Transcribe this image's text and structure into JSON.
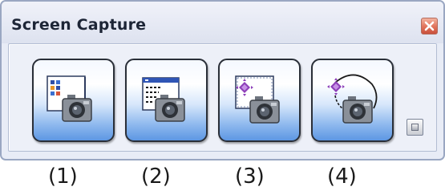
{
  "window": {
    "title": "Screen Capture"
  },
  "buttons": [
    {
      "id": "capture-full-screen",
      "icon": "desktop-camera-icon"
    },
    {
      "id": "capture-window",
      "icon": "window-camera-icon"
    },
    {
      "id": "capture-selected-area",
      "icon": "region-camera-icon"
    },
    {
      "id": "capture-freeform",
      "icon": "freeform-camera-icon"
    }
  ],
  "labels": [
    "(1)",
    "(2)",
    "(3)",
    "(4)"
  ],
  "colors": {
    "frame": "#9aa7c2",
    "button_gradient_bottom": "#5d97e3",
    "close_red": "#e0725a"
  }
}
